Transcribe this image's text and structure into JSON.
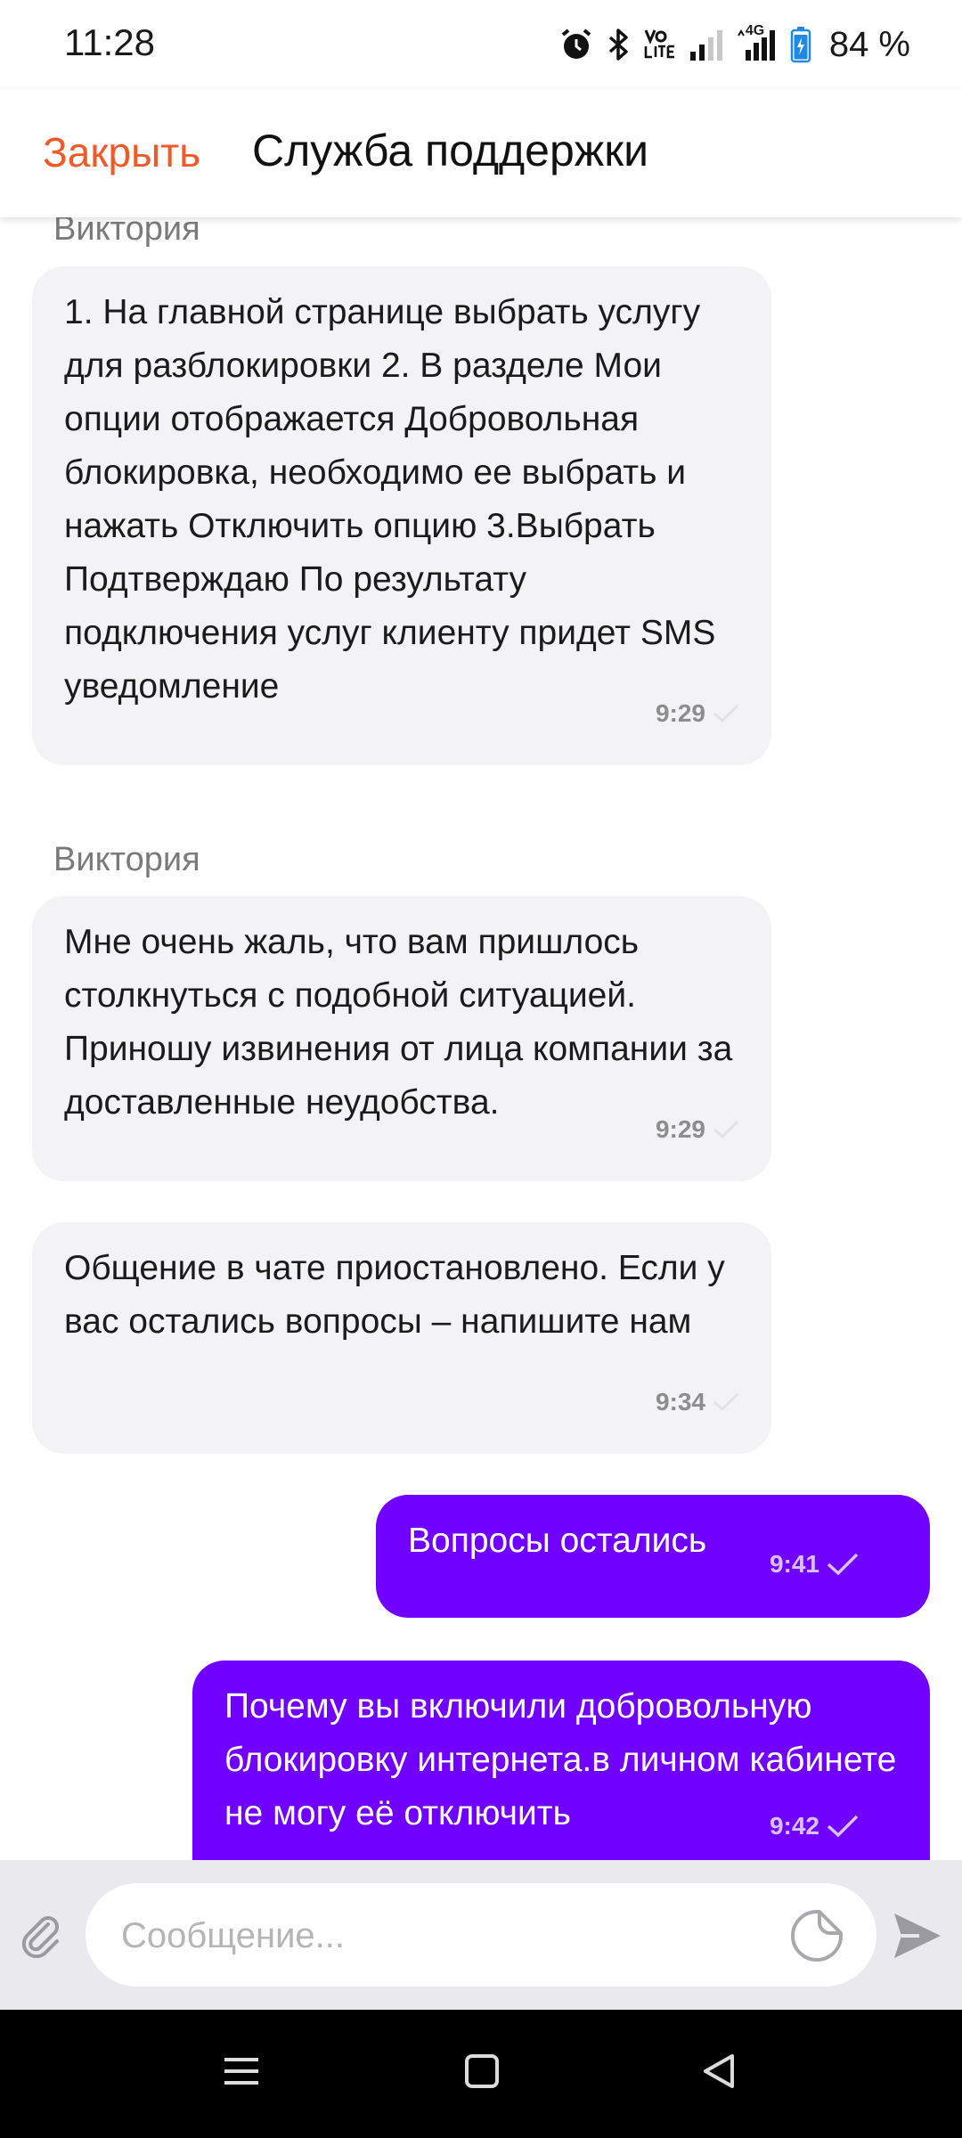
{
  "status_bar": {
    "time": "11:28",
    "network_label": "4G",
    "battery": "84 %"
  },
  "header": {
    "close_label": "Закрыть",
    "title": "Служба поддержки"
  },
  "messages": [
    {
      "direction": "in",
      "sender": "Виктория",
      "text": "1. На главной странице выбрать услугу для разблокировки 2. В разделе Мои опции отображается Добровольная блокировка, необходимо ее выбрать и нажать Отключить опцию 3.Выбрать Подтверждаю По результату подключения услуг клиенту придет SMS уведомление",
      "time": "9:29"
    },
    {
      "direction": "in",
      "sender": "Виктория",
      "text": "Мне очень жаль, что вам пришлось столкнуться с подобной ситуацией. Приношу извинения от лица компании за доставленные неудобства.",
      "time": "9:29"
    },
    {
      "direction": "in",
      "text": "Общение в чате приостановлено. Если у вас остались вопросы – напишите нам",
      "time": "9:34"
    },
    {
      "direction": "out",
      "text": "Вопросы остались",
      "time": "9:41"
    },
    {
      "direction": "out",
      "text": "Почему вы включили добровольную блокировку интернета.в личном кабинете не могу её отключить",
      "time": "9:42"
    }
  ],
  "input": {
    "placeholder": "Сообщение..."
  },
  "colors": {
    "accent": "#f05a28",
    "outgoing_bubble": "#7000ff",
    "incoming_bubble": "#f3f3f5"
  },
  "icons": {
    "attach": "paperclip-icon",
    "sticker": "sticker-icon",
    "send": "send-icon",
    "read_receipt": "check-icon"
  }
}
